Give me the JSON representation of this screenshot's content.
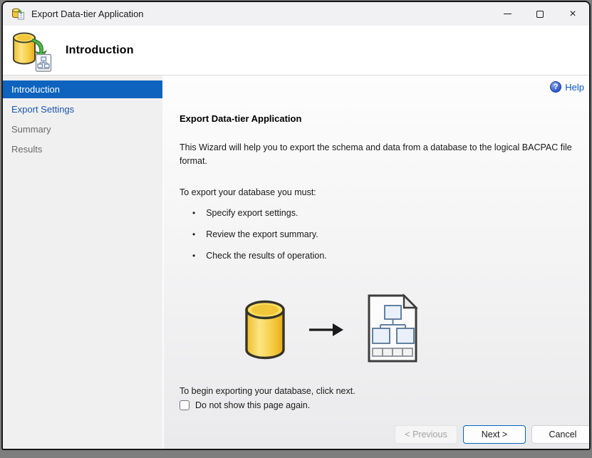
{
  "window": {
    "title": "Export Data-tier Application"
  },
  "icons": {
    "help_glyph": "?",
    "bullet_glyph": "•",
    "close_glyph": "×"
  },
  "header": {
    "title": "Introduction"
  },
  "sidebar": {
    "items": [
      {
        "label": "Introduction",
        "state": "selected"
      },
      {
        "label": "Export Settings",
        "state": "link"
      },
      {
        "label": "Summary",
        "state": "disabled"
      },
      {
        "label": "Results",
        "state": "disabled"
      }
    ]
  },
  "content": {
    "help_label": "Help",
    "heading": "Export Data-tier Application",
    "description": "This Wizard will help you to export the schema and data from a database to the logical BACPAC file format.",
    "steps_intro": "To export your database you must:",
    "steps": [
      "Specify export settings.",
      "Review the export summary.",
      "Check the results of operation."
    ],
    "next_note": "To begin exporting your database, click next.",
    "checkbox_label": "Do not show this page again.",
    "checkbox_checked": false
  },
  "buttons": {
    "previous": "< Previous",
    "next": "Next >",
    "cancel": "Cancel"
  },
  "colors": {
    "selected_nav_bg": "#0d63bd",
    "nav_link_blue": "#1b56ad",
    "help_blue": "#0a56c4",
    "next_button_border": "#0067c0",
    "database_yellow": "#f7cf3f",
    "arrow_green": "#56b44a"
  }
}
